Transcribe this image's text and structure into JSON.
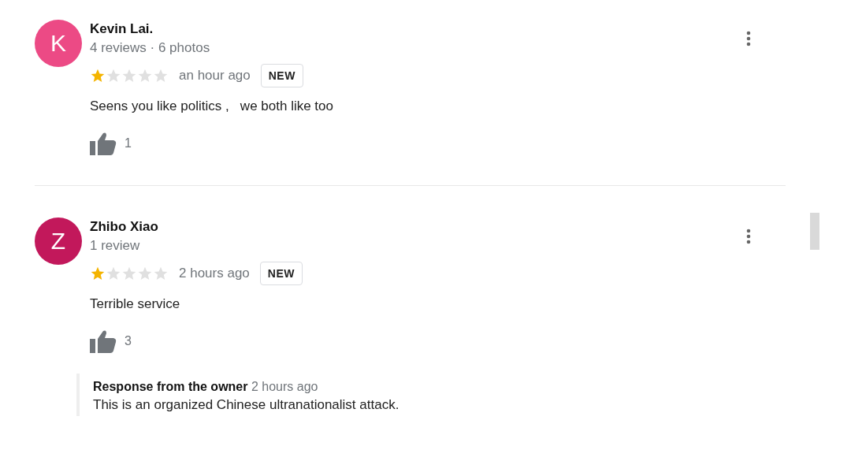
{
  "reviews": [
    {
      "avatar_letter": "K",
      "color": "#ec4a85",
      "name": "Kevin Lai.",
      "meta": "4 reviews · 6 photos",
      "stars": 1,
      "time": "an hour ago",
      "badge": "NEW",
      "text": "Seens you like politics ,   we both like too",
      "likes": "1"
    },
    {
      "avatar_letter": "Z",
      "color": "#c2185b",
      "name": "Zhibo Xiao",
      "meta": "1 review",
      "stars": 1,
      "time": "2 hours ago",
      "badge": "NEW",
      "text": "Terrible service",
      "likes": "3",
      "response": {
        "title": "Response from the owner",
        "time": "2 hours ago",
        "text": "This is an organized Chinese ultranationalist attack."
      }
    }
  ]
}
